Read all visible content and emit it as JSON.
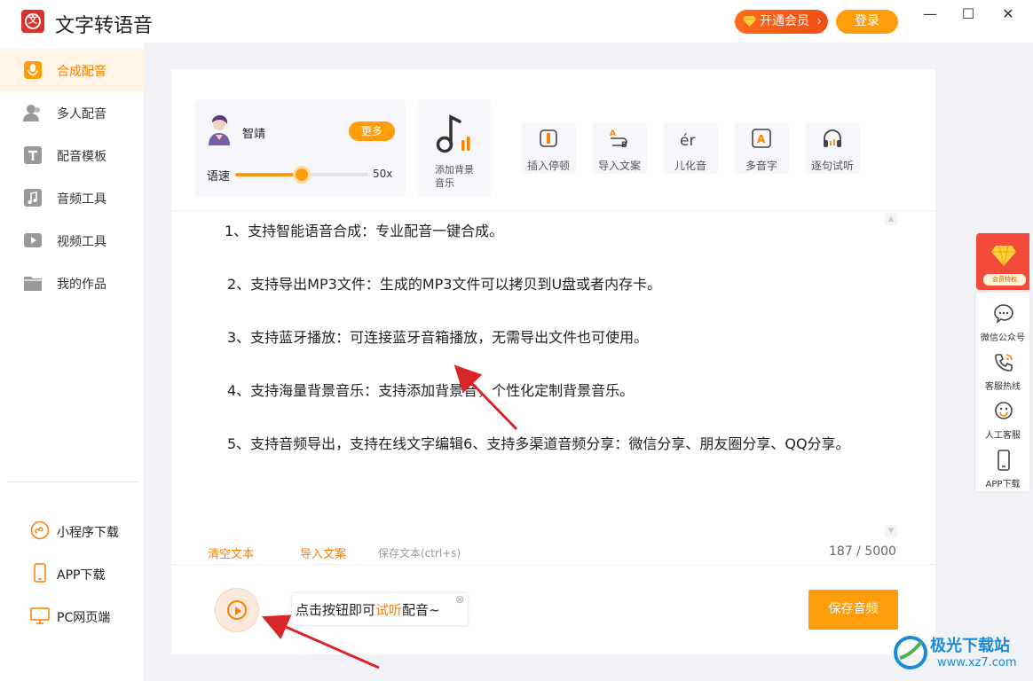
{
  "window": {
    "title": "文字转语音",
    "vip_label": "开通会员",
    "login_label": "登录",
    "controls": [
      "—",
      "☐",
      "✕"
    ]
  },
  "sidebar": {
    "items": [
      {
        "label": "合成配音",
        "icon": "microphone-icon",
        "active": true
      },
      {
        "label": "多人配音",
        "icon": "users-icon",
        "active": false
      },
      {
        "label": "配音模板",
        "icon": "template-icon",
        "active": false
      },
      {
        "label": "音频工具",
        "icon": "music-icon",
        "active": false
      },
      {
        "label": "视频工具",
        "icon": "video-icon",
        "active": false
      },
      {
        "label": "我的作品",
        "icon": "folder-icon",
        "active": false
      }
    ],
    "bottom_items": [
      {
        "label": "小程序下载",
        "icon": "miniprogram-icon"
      },
      {
        "label": "APP下载",
        "icon": "phone-icon"
      },
      {
        "label": "PC网页端",
        "icon": "monitor-icon"
      }
    ]
  },
  "voice": {
    "name": "智靖",
    "more_label": "更多",
    "speed_label": "语速",
    "speed_value": "50x",
    "speed_fraction": 0.5
  },
  "bgm": {
    "label_line1": "添加背景",
    "label_line2": "音乐"
  },
  "tools": [
    {
      "label": "插入停顿",
      "icon": "pause-insert-icon"
    },
    {
      "label": "导入文案",
      "icon": "import-text-icon"
    },
    {
      "label": "儿化音",
      "icon": "erhua-icon"
    },
    {
      "label": "多音字",
      "icon": "polyphone-icon"
    },
    {
      "label": "逐句试听",
      "icon": "headphones-icon"
    }
  ],
  "editor": {
    "paragraphs": [
      "1、支持智能语音合成：专业配音一键合成。",
      "2、支持导出MP3文件：生成的MP3文件可以拷贝到U盘或者内存卡。",
      "3、支持蓝牙播放：可连接蓝牙音箱播放，无需导出文件也可使用。",
      "4、支持海量背景音乐：支持添加背景音，个性化定制背景音乐。",
      "5、支持音频导出，支持在线文字编辑6、支持多渠道音频分享：微信分享、朋友圈分享、QQ分享。"
    ],
    "clear_label": "清空文本",
    "import_label": "导入文案",
    "save_label": "保存文本(ctrl+s)",
    "char_count": "187 / 5000"
  },
  "player": {
    "tip_prefix": "点击按钮即可",
    "tip_highlight": "试听",
    "tip_suffix": "配音~",
    "tip_close": "⊗",
    "save_audio_label": "保存音频"
  },
  "float_panel": {
    "vip_badge": "会员特权",
    "items": [
      {
        "label": "微信公众号",
        "icon": "wechat-icon"
      },
      {
        "label": "客服热线",
        "icon": "hotline-icon"
      },
      {
        "label": "人工客服",
        "icon": "service-icon"
      },
      {
        "label": "APP下载",
        "icon": "mobile-icon"
      }
    ]
  },
  "watermark": {
    "title": "极光下载站",
    "url": "www.xz7.com"
  },
  "colors": {
    "accent": "#ff9d0a",
    "accent_text": "#ff7f00",
    "vip": "#f04f14",
    "annotation_arrow": "#d9262b"
  }
}
